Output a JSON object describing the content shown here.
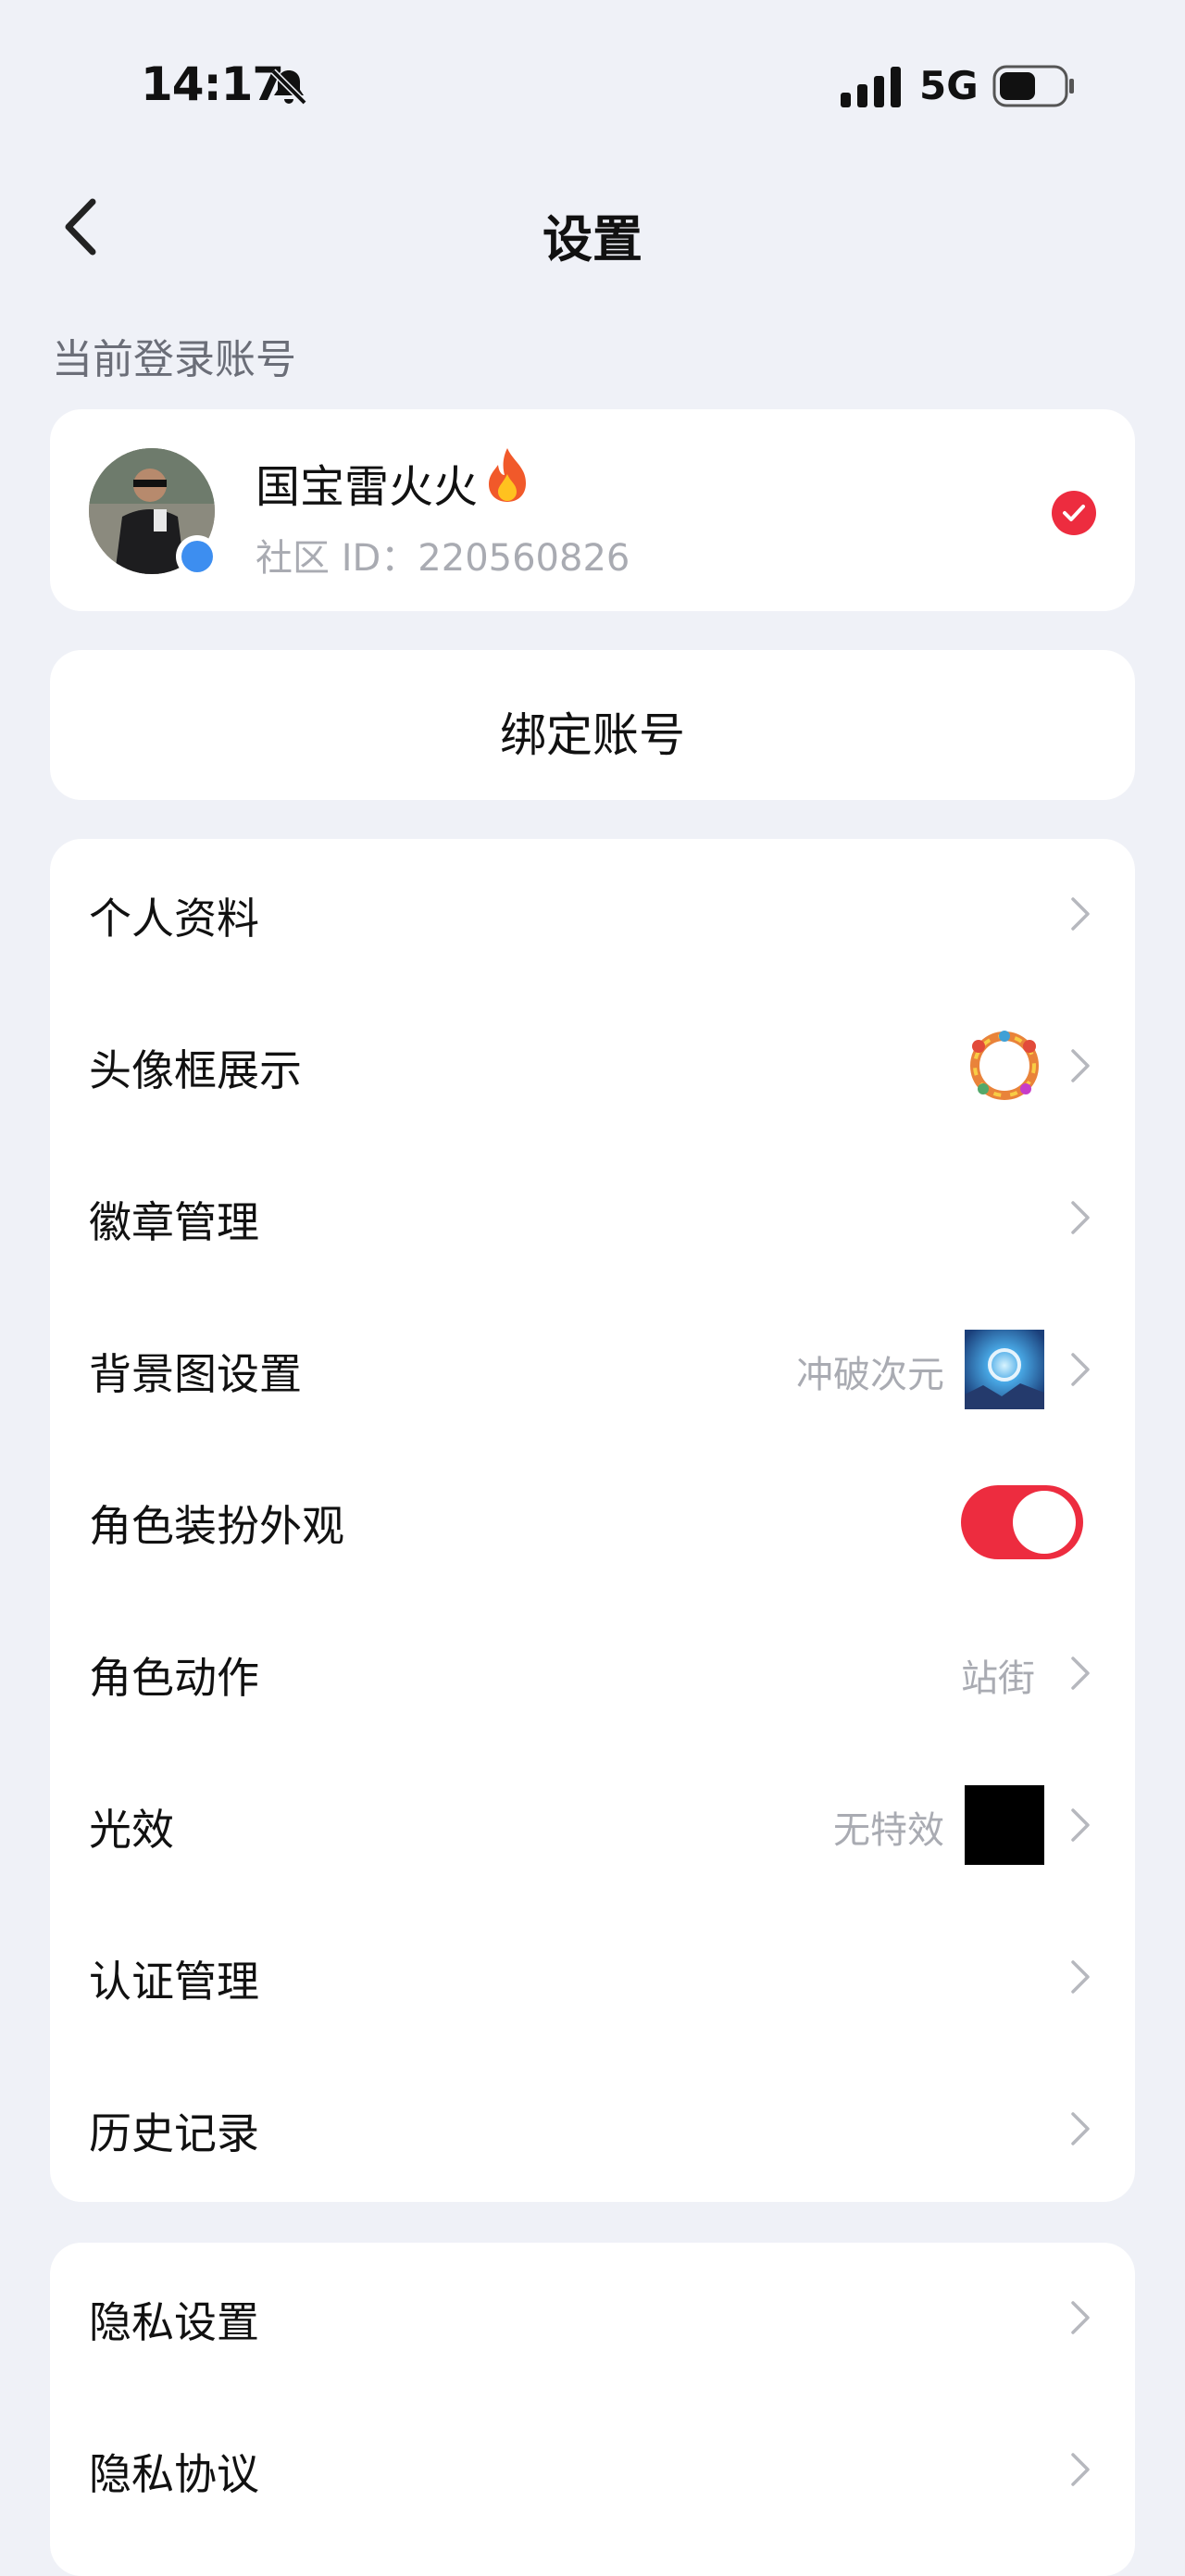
{
  "status_bar": {
    "time": "14:17",
    "network": "5G"
  },
  "nav": {
    "title": "设置"
  },
  "account_section": {
    "label": "当前登录账号",
    "nickname": "国宝雷火火",
    "id_text": "社区 ID：220560826"
  },
  "bind": {
    "label": "绑定账号"
  },
  "menu1": [
    {
      "label": "个人资料"
    },
    {
      "label": "头像框展示"
    },
    {
      "label": "徽章管理"
    },
    {
      "label": "背景图设置",
      "value": "冲破次元"
    },
    {
      "label": "角色装扮外观",
      "toggle_on": true
    },
    {
      "label": "角色动作",
      "value": "站街"
    },
    {
      "label": "光效",
      "value": "无特效"
    },
    {
      "label": "认证管理"
    },
    {
      "label": "历史记录"
    }
  ],
  "menu2": [
    {
      "label": "隐私设置"
    },
    {
      "label": "隐私协议"
    }
  ],
  "colors": {
    "accent": "#ed2c3f",
    "background": "#eff1f7",
    "muted": "#a9abb2"
  }
}
